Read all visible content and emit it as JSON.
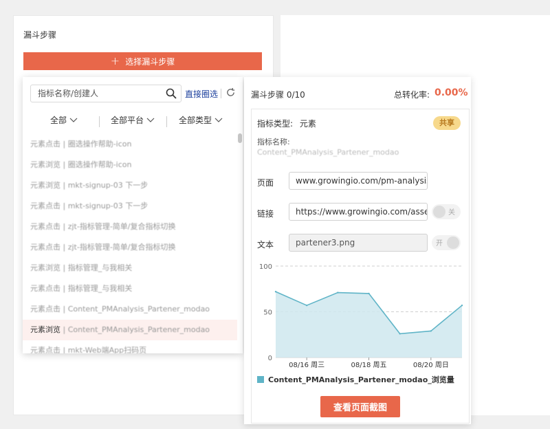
{
  "funnel": {
    "title": "漏斗步骤",
    "select_button": "选择漏斗步骤"
  },
  "search": {
    "placeholder": "指标名称/创建人",
    "direct_select": "直接圈选"
  },
  "filters": {
    "all": "全部",
    "platform": "全部平台",
    "type": "全部类型"
  },
  "list": [
    {
      "prefix": "元素点击",
      "name": "圈选操作帮助-icon"
    },
    {
      "prefix": "元素浏览",
      "name": "圈选操作帮助-icon"
    },
    {
      "prefix": "元素浏览",
      "name": "mkt-signup-03 下一步"
    },
    {
      "prefix": "元素点击",
      "name": "mkt-signup-03 下一步"
    },
    {
      "prefix": "元素点击",
      "name": "zjt-指标管理-简单/复合指标切换"
    },
    {
      "prefix": "元素点击",
      "name": "zjt-指标管理-简单/复合指标切换"
    },
    {
      "prefix": "元素浏览",
      "name": "指标管理_与我相关"
    },
    {
      "prefix": "元素点击",
      "name": "指标管理_与我相关"
    },
    {
      "prefix": "元素点击",
      "name": "Content_PMAnalysis_Partener_modao"
    },
    {
      "prefix": "元素浏览",
      "name": "Content_PMAnalysis_Partener_modao"
    },
    {
      "prefix": "元素点击",
      "name": "mkt-Web端App扫码页"
    }
  ],
  "steps": {
    "header": "漏斗步骤 0/10",
    "rate_label": "总转化率:",
    "rate_value": "0.00%"
  },
  "detail": {
    "type_label": "指标类型:",
    "type_value": "元素",
    "share_badge": "共享",
    "name_label": "指标名称:",
    "name_value": "Content_PMAnalysis_Partener_modao",
    "page_label": "页面",
    "page_value": "www.growingio.com/pm-analysis",
    "link_label": "链接",
    "link_value": "https://www.growingio.com/asset",
    "link_toggle": "关",
    "text_label": "文本",
    "text_value": "partener3.png",
    "text_toggle": "开",
    "view_button": "查看页面截图"
  },
  "chart_data": {
    "type": "area",
    "x": [
      "08/15",
      "08/16",
      "08/17",
      "08/18",
      "08/19",
      "08/20",
      "08/21"
    ],
    "x_tick_labels": [
      "08/16 周三",
      "08/18 周五",
      "08/20 周日"
    ],
    "y_ticks": [
      "100",
      "50",
      "0"
    ],
    "ylim": [
      0,
      100
    ],
    "series": [
      {
        "name": "Content_PMAnalysis_Partener_modao_浏览量",
        "values": [
          72,
          57,
          71,
          70,
          26,
          29,
          57
        ]
      }
    ],
    "color": "#5fb4c7",
    "grid": true
  },
  "colors": {
    "accent": "#e8674a",
    "link": "#1a3e9c",
    "badge": "#f7d98c"
  }
}
